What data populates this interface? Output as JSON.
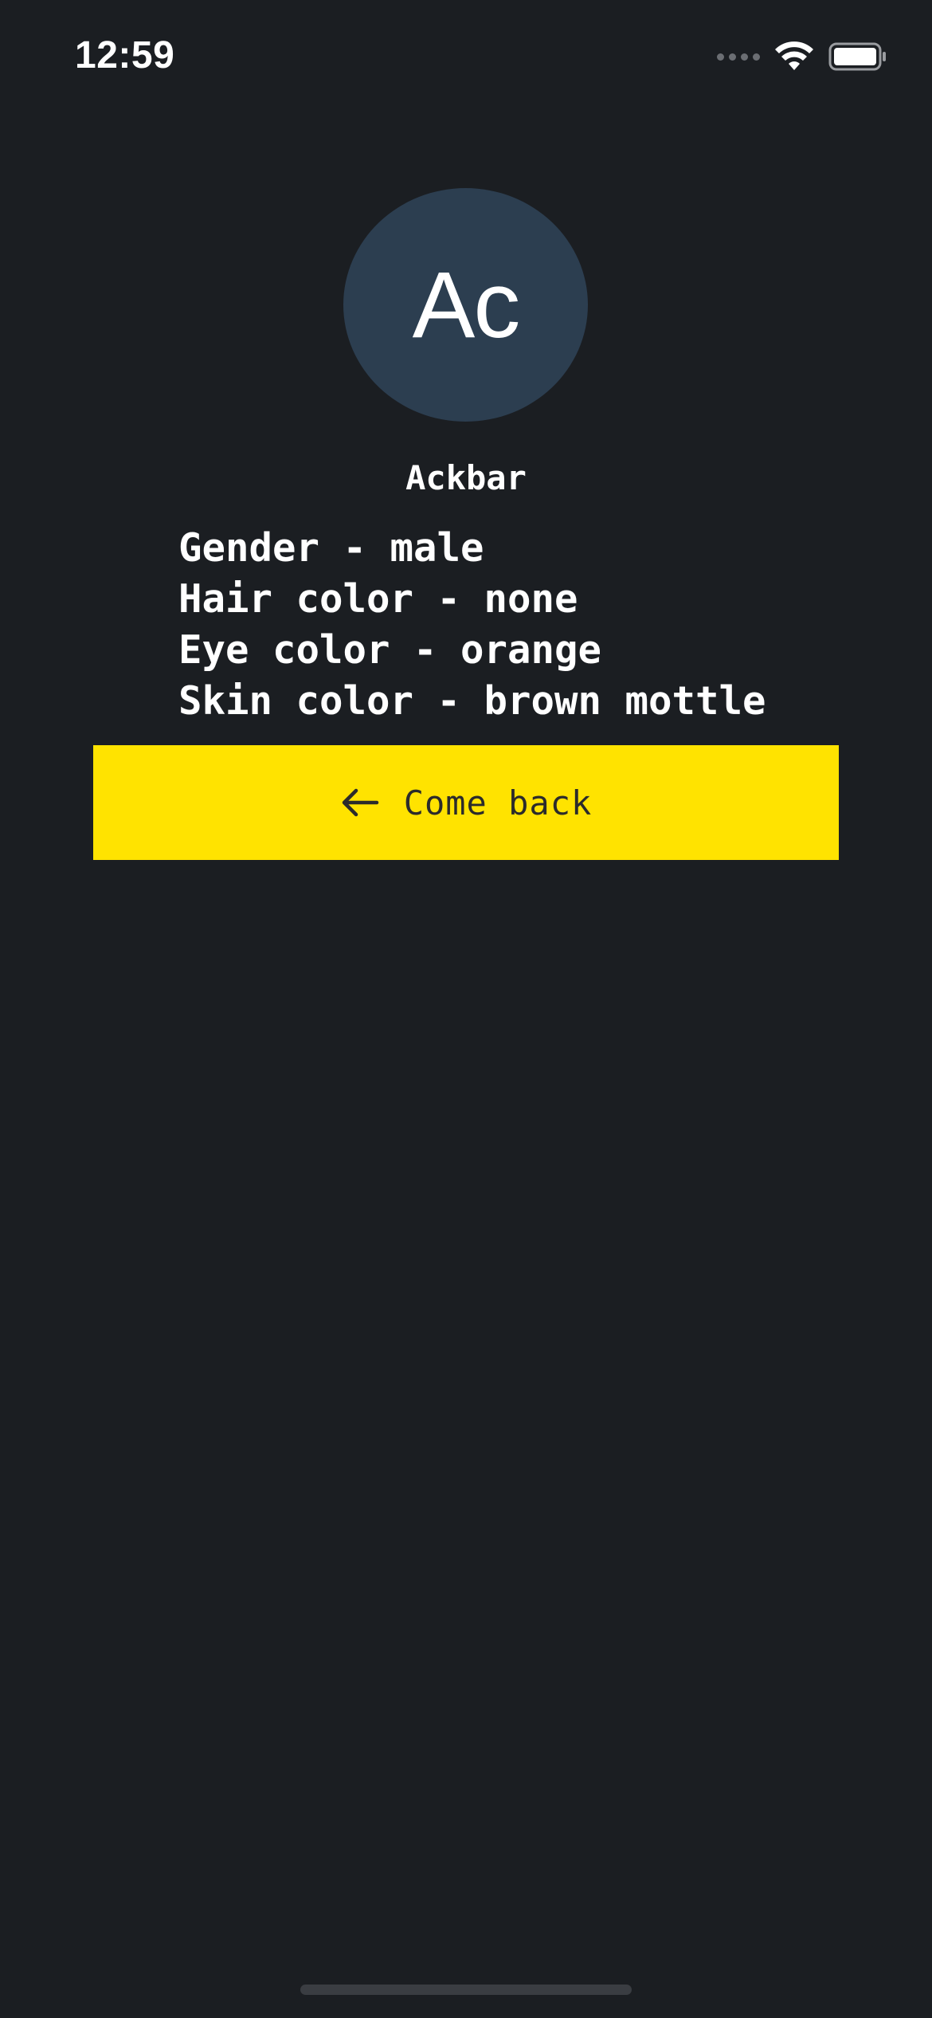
{
  "status_bar": {
    "time": "12:59",
    "icons": [
      "signal-dots-icon",
      "wifi-icon",
      "battery-icon"
    ]
  },
  "avatar": {
    "initials": "Ac",
    "background_color": "#2c3e50"
  },
  "character": {
    "name": "Ackbar",
    "details": [
      "Gender - male",
      "Hair color - none",
      "Eye color - orange",
      "Skin color - brown mottle"
    ]
  },
  "back_button": {
    "icon": "arrow-left-icon",
    "label": "Come back",
    "background_color": "#ffe300"
  },
  "theme": {
    "background": "#1b1e22",
    "text": "#ffffff"
  }
}
